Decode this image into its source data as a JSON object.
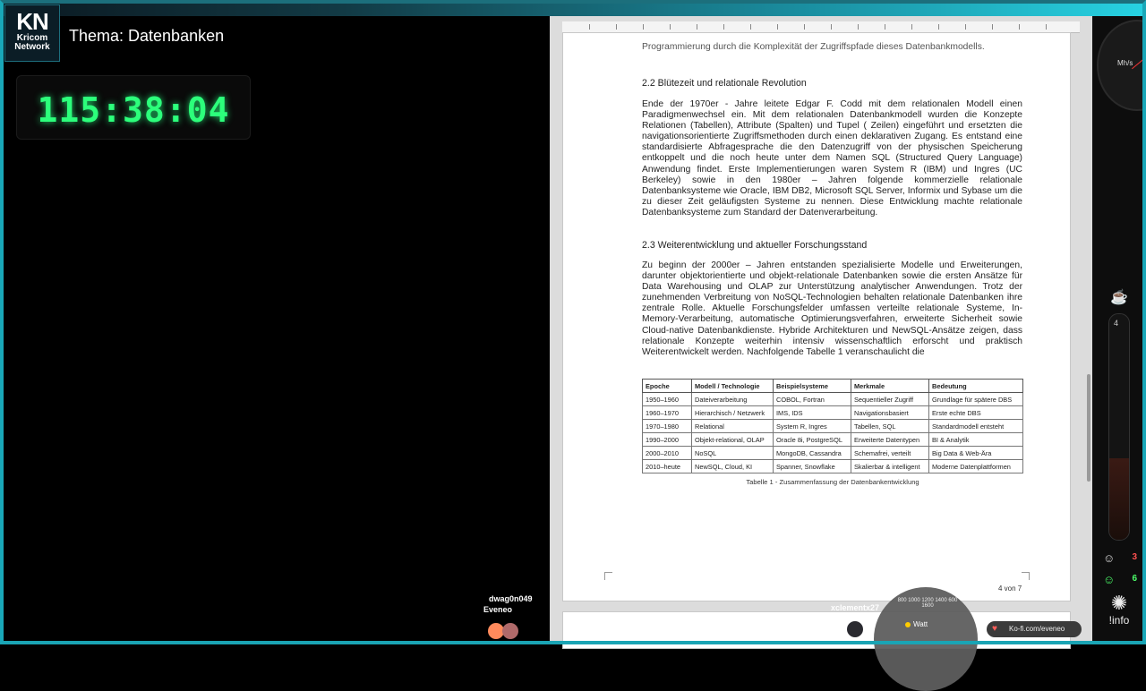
{
  "stream": {
    "logo_main": "KN",
    "logo_line1": "Kricom",
    "logo_line2": "Network",
    "theme": "Thema: Datenbanken",
    "timer": "115:38:04"
  },
  "document": {
    "cut_line": "Programmierung durch die Komplexität der Zugriffspfade dieses Datenbankmodells.",
    "section22_title": "2.2 Blütezeit und relationale Revolution",
    "section22_text": "Ende der 1970er - Jahre leitete Edgar F. Codd mit dem relationalen Modell einen Paradigmenwechsel ein. Mit dem relationalen Datenbankmodell wurden die Konzepte Relationen (Tabellen), Attribute (Spalten) und Tupel ( Zeilen) eingeführt und ersetzten die navigationsorientierte Zugriffsmethoden durch einen deklarativen Zugang. Es entstand eine standardisierte Abfragesprache die den Datenzugriff von der physischen Speicherung entkoppelt und die noch heute unter dem Namen SQL (Structured Query Language) Anwendung findet. Erste Implementierungen waren System R (IBM) und Ingres (UC Berkeley) sowie in den 1980er – Jahren folgende kommerzielle relationale Datenbanksysteme wie Oracle, IBM DB2, Microsoft SQL Server, Informix und Sybase um die zu dieser Zeit geläufigsten Systeme zu nennen. Diese Entwicklung machte relationale Datenbanksysteme zum Standard der Datenverarbeitung.",
    "section23_title": "2.3 Weiterentwicklung und aktueller Forschungsstand",
    "section23_text": "Zu beginn der 2000er – Jahren entstanden spezialisierte Modelle und Erweiterungen, darunter objektorientierte und objekt-relationale Datenbanken sowie die ersten Ansätze für Data Warehousing und OLAP zur Unterstützung analytischer Anwendungen. Trotz der zunehmenden Verbreitung von NoSQL-Technologien behalten relationale Datenbanken ihre zentrale Rolle. Aktuelle Forschungsfelder umfassen verteilte relationale Systeme, In-Memory-Verarbeitung, automatische Optimierungsverfahren, erweiterte Sicherheit sowie Cloud-native Datenbankdienste. Hybride Architekturen und NewSQL-Ansätze zeigen, dass relationale Konzepte weiterhin intensiv wissenschaftlich erforscht und praktisch Weiterentwickelt werden. Nachfolgende Tabelle 1 veranschaulicht die",
    "table_headers": [
      "Epoche",
      "Modell / Technologie",
      "Beispielsysteme",
      "Merkmale",
      "Bedeutung"
    ],
    "table_rows": [
      [
        "1950–1960",
        "Dateiverarbeitung",
        "COBOL, Fortran",
        "Sequentieller Zugriff",
        "Grundlage für spätere DBS"
      ],
      [
        "1960–1970",
        "Hierarchisch / Netzwerk",
        "IMS, IDS",
        "Navigationsbasiert",
        "Erste echte DBS"
      ],
      [
        "1970–1980",
        "Relational",
        "System R, Ingres",
        "Tabellen, SQL",
        "Standardmodell entsteht"
      ],
      [
        "1990–2000",
        "Objekt-relational, OLAP",
        "Oracle 8i, PostgreSQL",
        "Erweiterte Datentypen",
        "BI & Analytik"
      ],
      [
        "2000–2010",
        "NoSQL",
        "MongoDB, Cassandra",
        "Schemafrei, verteilt",
        "Big Data & Web-Ära"
      ],
      [
        "2010–heute",
        "NewSQL, Cloud, KI",
        "Spanner, Snowflake",
        "Skalierbar & intelligent",
        "Moderne Datenplattformen"
      ]
    ],
    "caption": "Tabelle 1 - Zusammenfassung der Datenbankentwicklung",
    "page_number": "4 von 7"
  },
  "overlay": {
    "speed_unit": "Mh/s",
    "thermo_value": "4",
    "counter_red": "3",
    "counter_green": "6",
    "info_label": "!info",
    "chat_user1": "dwag0n049",
    "chat_user2": "Eveneo",
    "watt_user": "xclementx27",
    "watt_label": "Watt",
    "watt_scale": "800 1000 1200 1400 600 1600",
    "kofi": "Ko-fi.com/eveneo",
    "colors": {
      "timer": "#2cff7b",
      "frame": "#19a7b8",
      "counter_red": "#ff5050",
      "counter_green": "#4cff6a"
    }
  }
}
